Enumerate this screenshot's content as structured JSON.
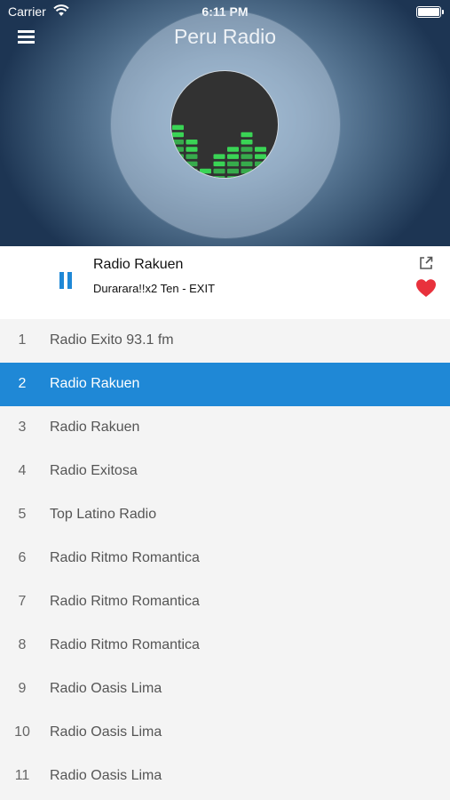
{
  "status_bar": {
    "carrier": "Carrier",
    "time": "6:11 PM"
  },
  "header": {
    "title": "Peru Radio"
  },
  "now_playing": {
    "station": "Radio Rakuen",
    "track": "Durarara!!x2 Ten - EXIT"
  },
  "colors": {
    "accent": "#1f88d6",
    "favorite": "#e8313c",
    "equalizer": "#3ad455"
  },
  "stations": [
    {
      "number": "1",
      "name": "Radio Exito 93.1 fm"
    },
    {
      "number": "2",
      "name": "Radio Rakuen",
      "selected": true
    },
    {
      "number": "3",
      "name": "Radio Rakuen"
    },
    {
      "number": "4",
      "name": "Radio Exitosa"
    },
    {
      "number": "5",
      "name": "Top Latino Radio"
    },
    {
      "number": "6",
      "name": "Radio Ritmo Romantica"
    },
    {
      "number": "7",
      "name": "Radio Ritmo Romantica"
    },
    {
      "number": "8",
      "name": "Radio Ritmo Romantica"
    },
    {
      "number": "9",
      "name": "Radio Oasis Lima"
    },
    {
      "number": "10",
      "name": "Radio Oasis Lima"
    },
    {
      "number": "11",
      "name": "Radio Oasis Lima"
    }
  ]
}
